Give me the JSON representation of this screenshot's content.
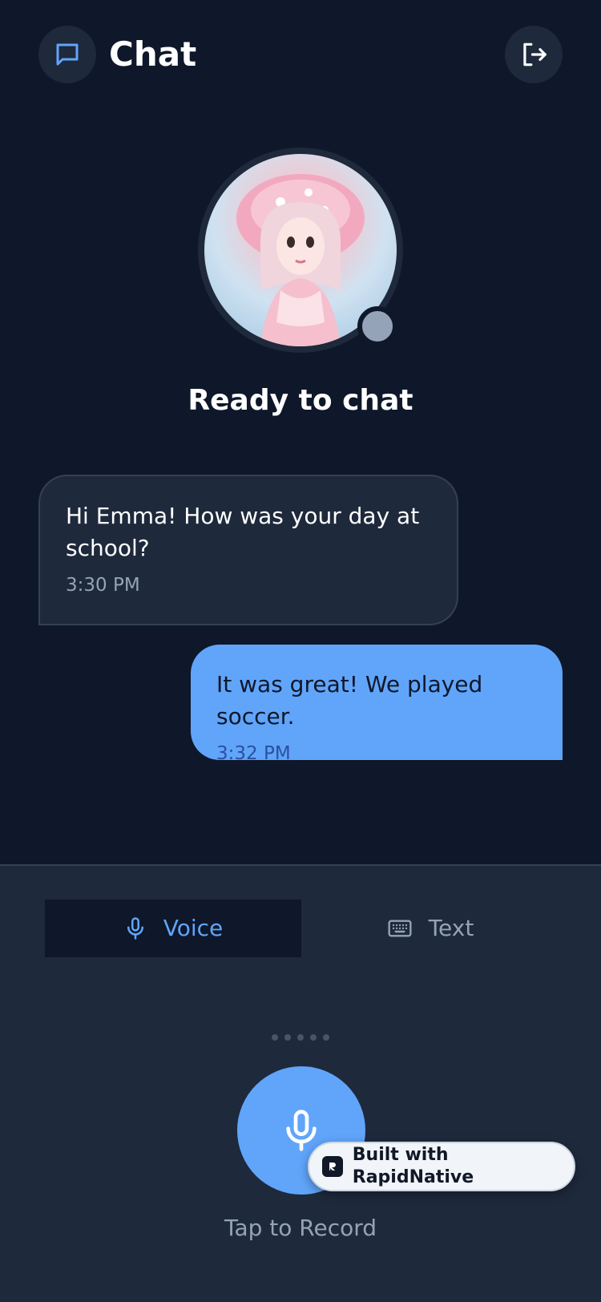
{
  "header": {
    "title": "Chat",
    "chat_icon": "chat-bubble-icon",
    "logout_icon": "logout-icon"
  },
  "profile": {
    "avatar": "doll-avatar",
    "status_text": "Ready to chat"
  },
  "messages": [
    {
      "direction": "incoming",
      "text": "Hi Emma! How was your day at school?",
      "time": "3:30 PM"
    },
    {
      "direction": "outgoing",
      "text": "It was great! We played soccer.",
      "time": "3:32 PM"
    }
  ],
  "input_modes": {
    "voice_label": "Voice",
    "text_label": "Text",
    "active": "Voice"
  },
  "recorder": {
    "label": "Tap to Record",
    "icon": "microphone-icon"
  },
  "badge": {
    "label": "Built with RapidNative"
  },
  "colors": {
    "background": "#0f172a",
    "panel": "#1e293b",
    "accent": "#60a5fa",
    "muted": "#94a3b8"
  }
}
